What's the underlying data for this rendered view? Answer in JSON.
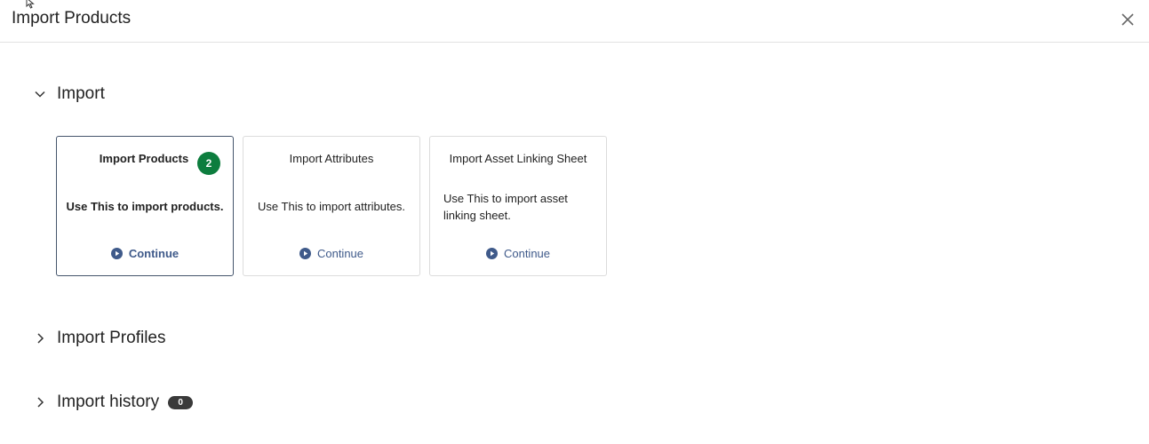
{
  "dialog": {
    "title": "Import Products"
  },
  "sections": {
    "import": {
      "label": "Import",
      "expanded": true
    },
    "profiles": {
      "label": "Import Profiles",
      "expanded": false
    },
    "history": {
      "label": "Import history",
      "expanded": false,
      "count": "0"
    }
  },
  "cards": [
    {
      "title": "Import Products",
      "description": "Use This to import products.",
      "continue_label": "Continue",
      "step": "2",
      "selected": true
    },
    {
      "title": "Import Attributes",
      "description": "Use This to import attributes.",
      "continue_label": "Continue",
      "selected": false
    },
    {
      "title": "Import Asset Linking Sheet",
      "description": "Use This to import asset linking sheet.",
      "continue_label": "Continue",
      "selected": false
    }
  ],
  "colors": {
    "accent": "#3f5a8a",
    "step_badge": "#0d7d3e",
    "selected_border": "#45556c",
    "count_badge": "#3a3a3a"
  }
}
